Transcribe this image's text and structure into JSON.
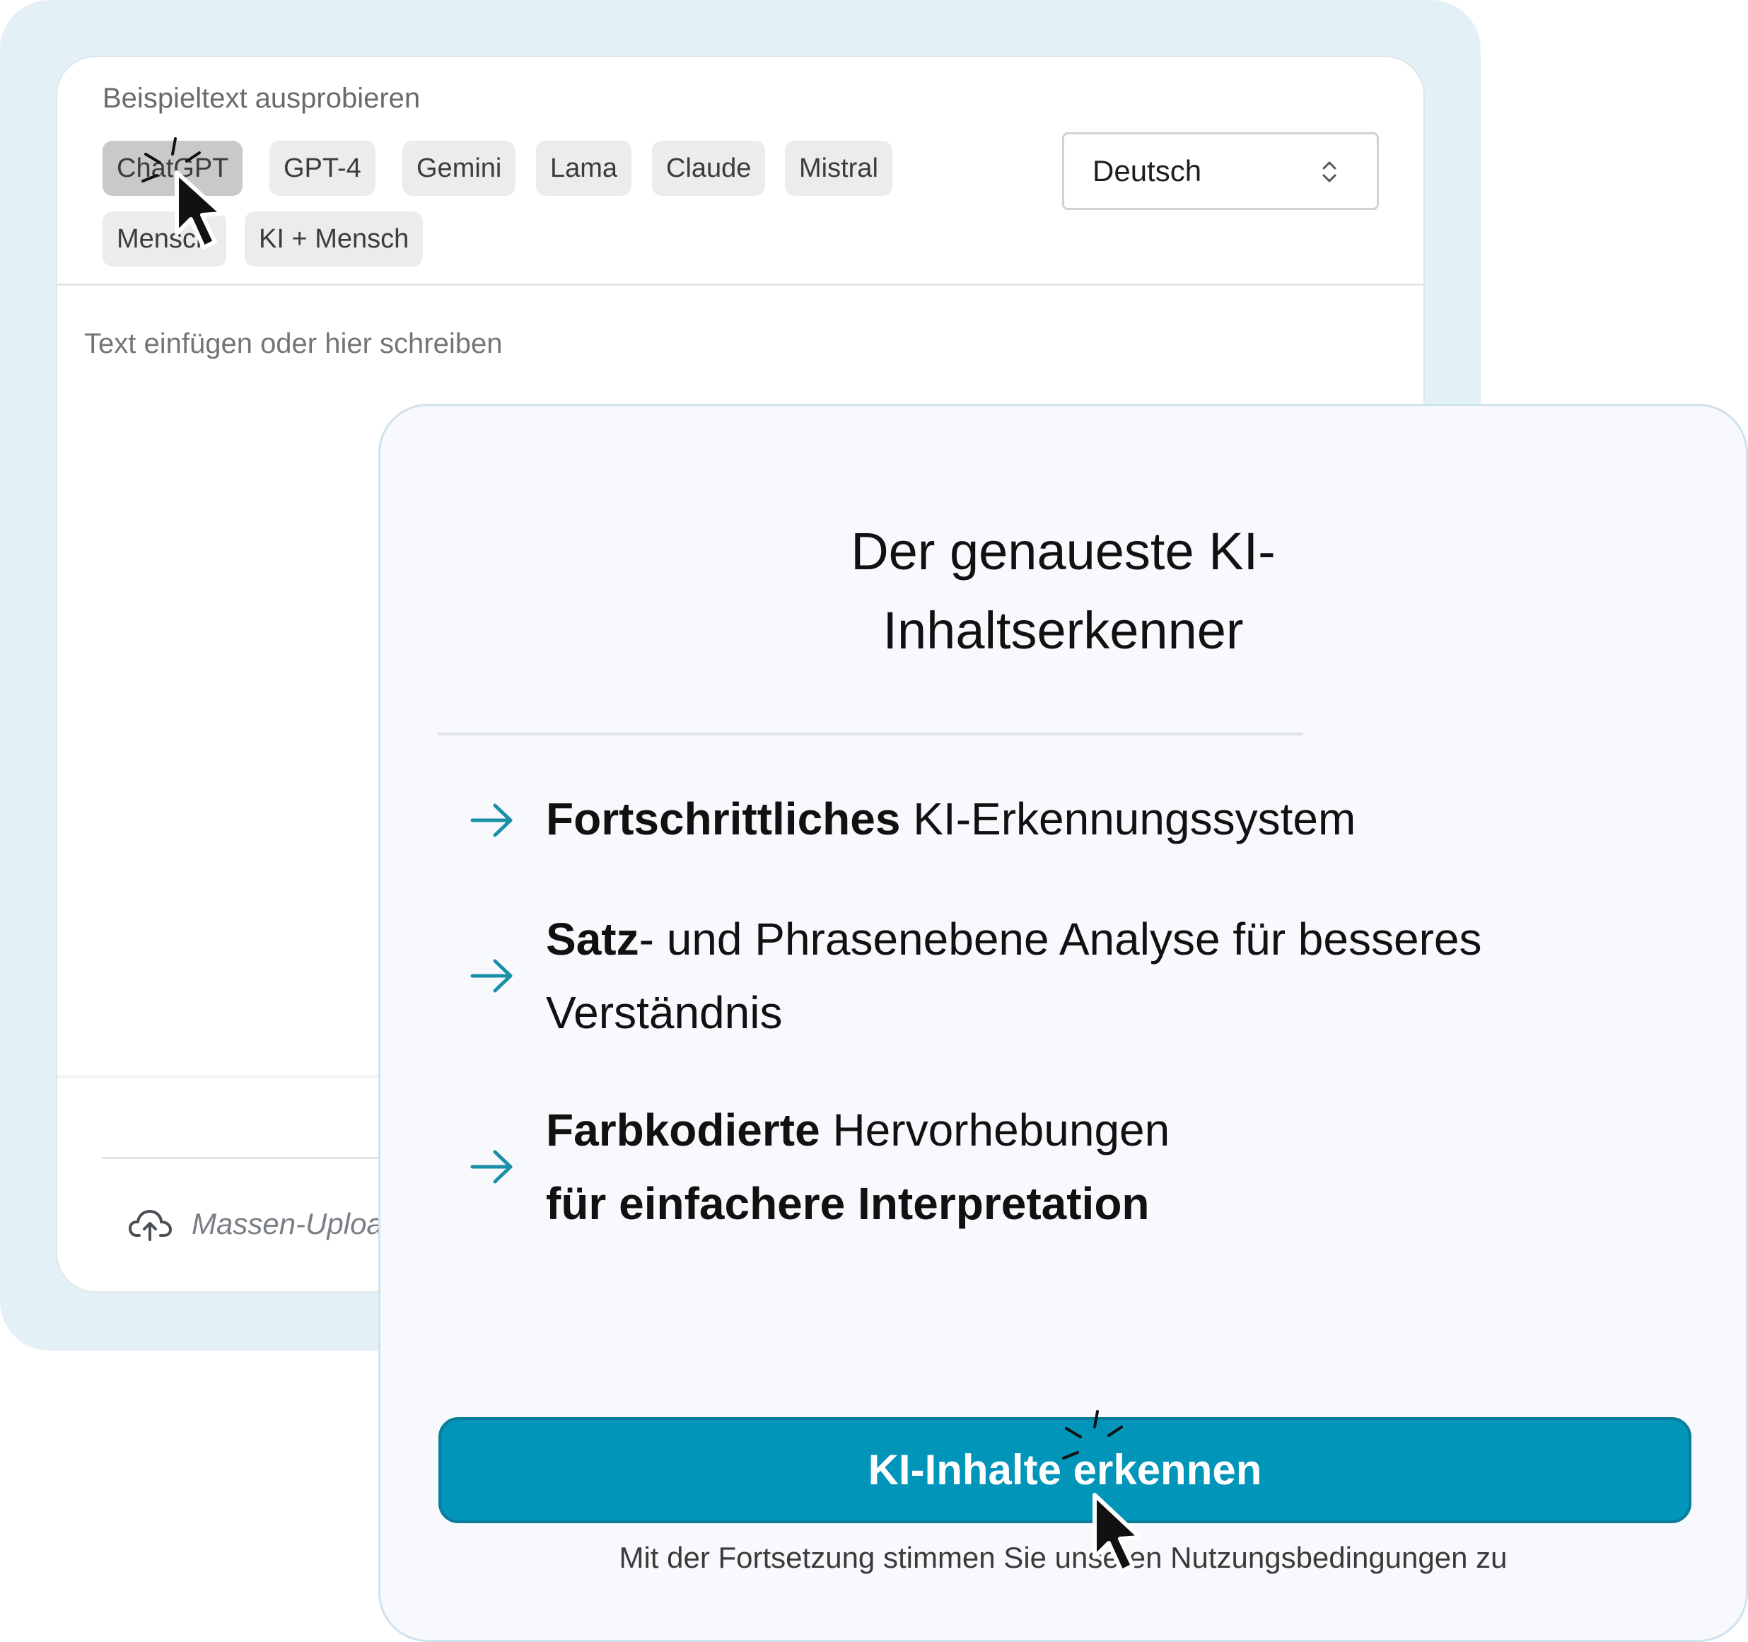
{
  "editor": {
    "sample_label": "Beispieltext ausprobieren",
    "chips": [
      "ChatGPT",
      "GPT-4",
      "Gemini",
      "Lama",
      "Claude",
      "Mistral",
      "Mensch",
      "KI + Mensch"
    ],
    "active_chip": "ChatGPT",
    "language": "Deutsch",
    "text_placeholder": "Text einfügen oder hier schreiben",
    "upload_label": "Massen-Uploa"
  },
  "info": {
    "title_line1": "Der genaueste KI-",
    "title_line2": "Inhaltserkenner",
    "features": [
      {
        "bold": "Fortschrittliches",
        "rest": " KI-Erkennungssystem"
      },
      {
        "bold": "Satz",
        "rest": "- und Phrasenebene Analyse für besseres Verständnis"
      },
      {
        "bold": "Farbkodierte",
        "rest": " Hervorhebungen",
        "bold2": "für einfachere Interpretation"
      }
    ],
    "cta_label": "KI-Inhalte erkennen",
    "terms_text": "Mit der Fortsetzung stimmen Sie unseren Nutzungsbedingungen zu"
  },
  "colors": {
    "accent": "#0095b9",
    "arrow": "#1a8fa8",
    "background_panel": "#e3f1f7"
  },
  "icons": [
    "arrow-right-icon",
    "cloud-upload-icon",
    "chevron-updown-icon",
    "cursor-icon"
  ]
}
